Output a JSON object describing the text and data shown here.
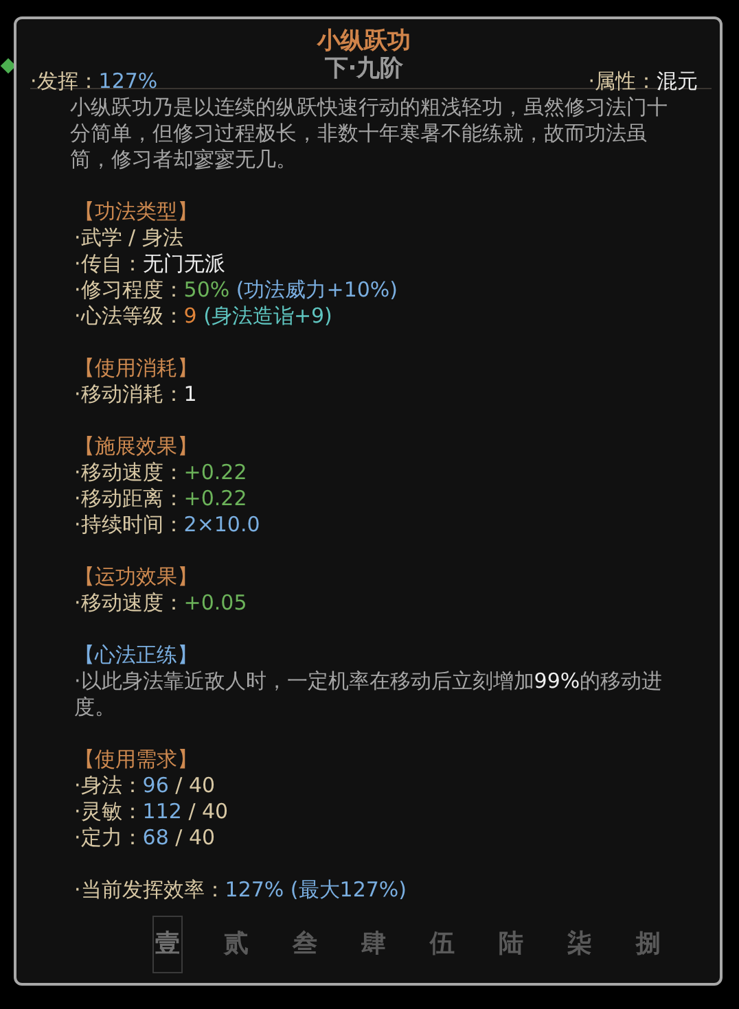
{
  "title": "小纵跃功",
  "grade": "下·九阶",
  "performance": {
    "label": "·发挥：",
    "value": "127%"
  },
  "attribute": {
    "label": "·属性：",
    "value": "混元"
  },
  "description": "小纵跃功乃是以连续的纵跃快速行动的粗浅轻功，虽然修习法门十分简单，但修习过程极长，非数十年寒暑不能练就，故而功法虽简，修习者却寥寥无几。",
  "sections": [
    {
      "heading": "【功法类型】",
      "kind": "orange",
      "lines": [
        [
          {
            "text": "·武学 / 身法",
            "kind": "tan"
          }
        ],
        [
          {
            "text": "·传自：",
            "kind": "tan"
          },
          {
            "text": "无门无派",
            "kind": "white"
          }
        ],
        [
          {
            "text": "·修习程度：",
            "kind": "tan"
          },
          {
            "text": "50%",
            "kind": "green"
          },
          {
            "text": " (功法威力+10%)",
            "kind": "blue"
          }
        ],
        [
          {
            "text": "·心法等级：",
            "kind": "tan"
          },
          {
            "text": "9",
            "kind": "orange"
          },
          {
            "text": " (身法造诣+9)",
            "kind": "cyan"
          }
        ]
      ]
    },
    {
      "heading": "【使用消耗】",
      "kind": "orange",
      "lines": [
        [
          {
            "text": "·移动消耗：",
            "kind": "tan"
          },
          {
            "text": "1",
            "kind": "white"
          }
        ]
      ]
    },
    {
      "heading": "【施展效果】",
      "kind": "orange",
      "lines": [
        [
          {
            "text": "·移动速度：",
            "kind": "tan"
          },
          {
            "text": "+0.22",
            "kind": "green"
          }
        ],
        [
          {
            "text": "·移动距离：",
            "kind": "tan"
          },
          {
            "text": "+0.22",
            "kind": "green"
          }
        ],
        [
          {
            "text": "·持续时间：",
            "kind": "tan"
          },
          {
            "text": "2×10.0",
            "kind": "blue"
          }
        ]
      ]
    },
    {
      "heading": "【运功效果】",
      "kind": "orange",
      "lines": [
        [
          {
            "text": "·移动速度：",
            "kind": "tan"
          },
          {
            "text": "+0.05",
            "kind": "green"
          }
        ]
      ]
    },
    {
      "heading": "【心法正练】",
      "kind": "blue",
      "lines": [
        [
          {
            "text": "·以此身法靠近敌人时，一定机率在移动后立刻增加",
            "kind": "gray"
          },
          {
            "text": "99%",
            "kind": "white"
          },
          {
            "text": "的移动进度。",
            "kind": "gray"
          }
        ]
      ]
    },
    {
      "heading": "【使用需求】",
      "kind": "orange",
      "lines": [
        [
          {
            "text": "·身法：",
            "kind": "tan"
          },
          {
            "text": "96",
            "kind": "blue"
          },
          {
            "text": " / 40",
            "kind": "tan"
          }
        ],
        [
          {
            "text": "·灵敏：",
            "kind": "tan"
          },
          {
            "text": "112",
            "kind": "blue"
          },
          {
            "text": " / 40",
            "kind": "tan"
          }
        ],
        [
          {
            "text": "·定力：",
            "kind": "tan"
          },
          {
            "text": "68",
            "kind": "blue"
          },
          {
            "text": " / 40",
            "kind": "tan"
          }
        ]
      ]
    },
    {
      "lines": [
        [
          {
            "text": "·当前发挥效率：",
            "kind": "tan"
          },
          {
            "text": "127% (最大127%)",
            "kind": "blue"
          }
        ]
      ]
    }
  ],
  "background_tabs": [
    {
      "label": "壹",
      "selected": true
    },
    {
      "label": "贰",
      "selected": false
    },
    {
      "label": "叁",
      "selected": false
    },
    {
      "label": "肆",
      "selected": false
    },
    {
      "label": "伍",
      "selected": false
    },
    {
      "label": "陆",
      "selected": false
    },
    {
      "label": "柒",
      "selected": false
    },
    {
      "label": "捌",
      "selected": false
    }
  ]
}
